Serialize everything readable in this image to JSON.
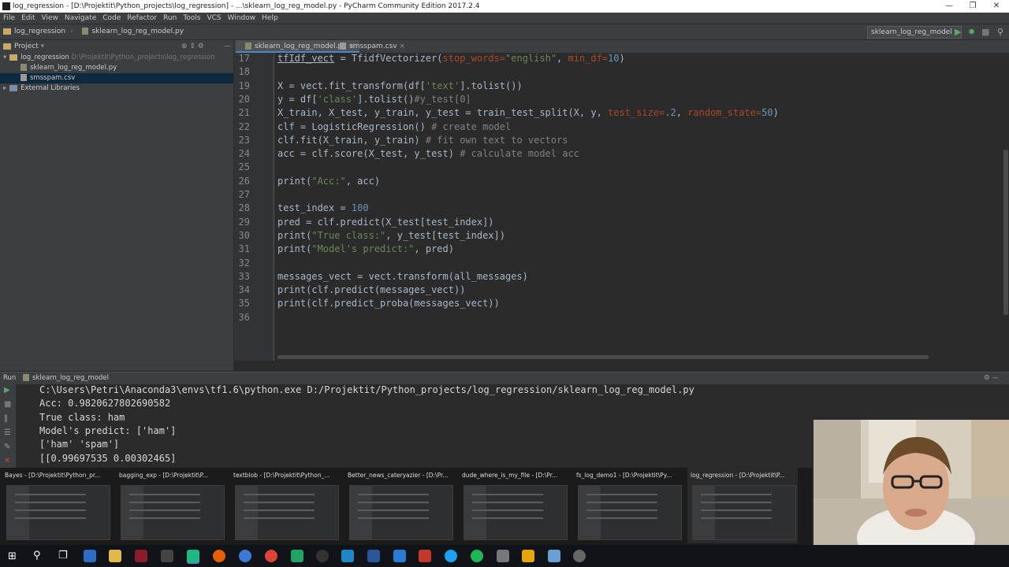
{
  "window": {
    "title": "log_regression - [D:\\Projektit\\Python_projects\\log_regression] - ...\\sklearn_log_reg_model.py - PyCharm Community Edition 2017.2.4"
  },
  "menu": [
    "File",
    "Edit",
    "View",
    "Navigate",
    "Code",
    "Refactor",
    "Run",
    "Tools",
    "VCS",
    "Window",
    "Help"
  ],
  "breadcrumb": {
    "project": "log_regression",
    "file": "sklearn_log_reg_model.py"
  },
  "run_config": "sklearn_log_reg_model",
  "project_panel": {
    "title": "Project",
    "root": "log_regression",
    "root_path": "D:\\Projektit\\Python_projects\\log_regression",
    "files": [
      "sklearn_log_reg_model.py",
      "smsspam.csv"
    ],
    "external": "External Libraries"
  },
  "editor_tabs": [
    "sklearn_log_reg_model.py",
    "smsspam.csv"
  ],
  "code_lines": [
    {
      "n": "17"
    },
    {
      "n": "18"
    },
    {
      "n": "19"
    },
    {
      "n": "20"
    },
    {
      "n": "21"
    },
    {
      "n": "22"
    },
    {
      "n": "23"
    },
    {
      "n": "24"
    },
    {
      "n": "25"
    },
    {
      "n": "26"
    },
    {
      "n": "27"
    },
    {
      "n": "28"
    },
    {
      "n": "29"
    },
    {
      "n": "30"
    },
    {
      "n": "31"
    },
    {
      "n": "32"
    },
    {
      "n": "33"
    },
    {
      "n": "34"
    },
    {
      "n": "35"
    },
    {
      "n": "36"
    }
  ],
  "code": {
    "l17a": "tfIdf_vect",
    "l17b": " = TfidfVectorizer(",
    "l17c": "stop_words=",
    "l17d": "\"english\"",
    "l17e": ", ",
    "l17f": "min_df=",
    "l17g": "10",
    "l17h": ")",
    "l19": "X = vect.fit_transform(df[",
    "l19s": "'text'",
    "l19e": "].tolist())",
    "l20": "y = df[",
    "l20s": "'class'",
    "l20e": "].tolist()",
    "l20c": "#y_test[0]",
    "l21": "X_train, X_test, y_train, y_test = train_test_split(X, y, ",
    "l21p": "test_size=",
    "l21n": ".2",
    "l21x": ", ",
    "l21q": "random_state=",
    "l21m": "50",
    "l21e": ")",
    "l22": "clf = LogisticRegression() ",
    "l22c": "# create model",
    "l23": "clf.fit(X_train, y_train) ",
    "l23c": "# fit own text to vectors",
    "l24": "acc = clf.score(X_test, y_test) ",
    "l24c": "# calculate model acc",
    "l26": "print(",
    "l26s": "\"Acc:\"",
    "l26e": ", acc)",
    "l28": "test_index = ",
    "l28n": "100",
    "l29": "pred = clf.predict(X_test[test_index])",
    "l30": "print(",
    "l30s": "\"True class:\"",
    "l30e": ", y_test[test_index])",
    "l31": "print(",
    "l31s": "\"Model's predict:\"",
    "l31e": ", pred)",
    "l33": "messages_vect = vect.transform(all_messages)",
    "l34": "print(clf.predict(messages_vect))",
    "l35": "print(clf.predict_proba(messages_vect))"
  },
  "run_panel": {
    "label": "Run",
    "config": "sklearn_log_reg_model",
    "output": [
      "C:\\Users\\Petri\\Anaconda3\\envs\\tf1.6\\python.exe D:/Projektit/Python_projects/log_regression/sklearn_log_reg_model.py",
      "Acc: 0.9820627802690582",
      "True class: ham",
      "Model's predict: ['ham']",
      "['ham' 'spam']",
      "[[0.99697535 0.00302465]"
    ]
  },
  "taskbar_previews": [
    "Bayes - [D:\\Projektit\\Python_pr...",
    "bagging_exp - [D:\\Projektit\\P...",
    "textblob - [D:\\Projektit\\Python_...",
    "Better_news_cateryazier - [D:\\Pr...",
    "dude_where_is_my_file - [D:\\Pr...",
    "fs_log_demo1 - [D:\\Projektit\\Py...",
    "log_regression - [D:\\Projektit\\P..."
  ],
  "colors": {
    "accent": "#4a88c7",
    "keyword": "#cc7832",
    "string": "#6a8759",
    "number": "#6897bb",
    "comment": "#808080",
    "param": "#aa4926"
  }
}
